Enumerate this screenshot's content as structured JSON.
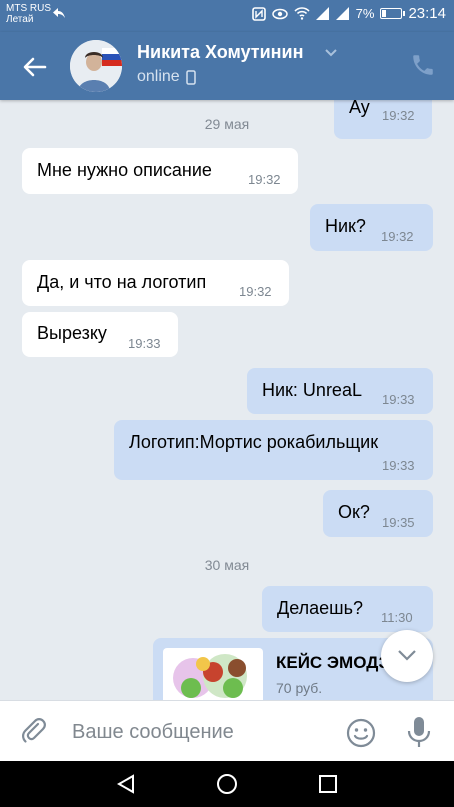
{
  "status_bar": {
    "carrier_line1": "MTS RUS",
    "carrier_line2": "Летай",
    "battery_percent": "7%",
    "clock": "23:14"
  },
  "header": {
    "contact_name": "Никита Хомутинин",
    "status": "online"
  },
  "chat": {
    "messages": [
      {
        "direction": "out",
        "text": "Ау",
        "time": "19:32"
      },
      {
        "type": "date",
        "text": "29 мая"
      },
      {
        "direction": "in",
        "text": "Мне нужно описание",
        "time": "19:32"
      },
      {
        "direction": "out",
        "text": "Ник?",
        "time": "19:32"
      },
      {
        "direction": "in",
        "text": "Да, и что на логотип",
        "time": "19:32"
      },
      {
        "direction": "in",
        "text": "Вырезку",
        "time": "19:33"
      },
      {
        "direction": "out",
        "text": "Ник: UnreaL",
        "time": "19:33"
      },
      {
        "direction": "out",
        "text": "Логотип:Мортис рокабильщик",
        "time": "19:33"
      },
      {
        "direction": "out",
        "text": "Ок?",
        "time": "19:35"
      },
      {
        "type": "date",
        "text": "30 мая"
      },
      {
        "direction": "out",
        "text": "Делаешь?",
        "time": "11:30"
      },
      {
        "direction": "out",
        "type": "product",
        "title": "КЕЙС ЭМОДЗ",
        "price": "70 руб."
      }
    ]
  },
  "input": {
    "placeholder": "Ваше сообщение"
  },
  "colors": {
    "header": "#4a76a8",
    "background": "#e6ebf0",
    "bubble_in": "#ffffff",
    "bubble_out": "#cbdcf4"
  },
  "icons": [
    "back-arrow-icon",
    "chevron-down-icon",
    "phone-icon",
    "mobile-icon",
    "attach-icon",
    "emoji-icon",
    "mic-icon",
    "scroll-down-icon"
  ]
}
